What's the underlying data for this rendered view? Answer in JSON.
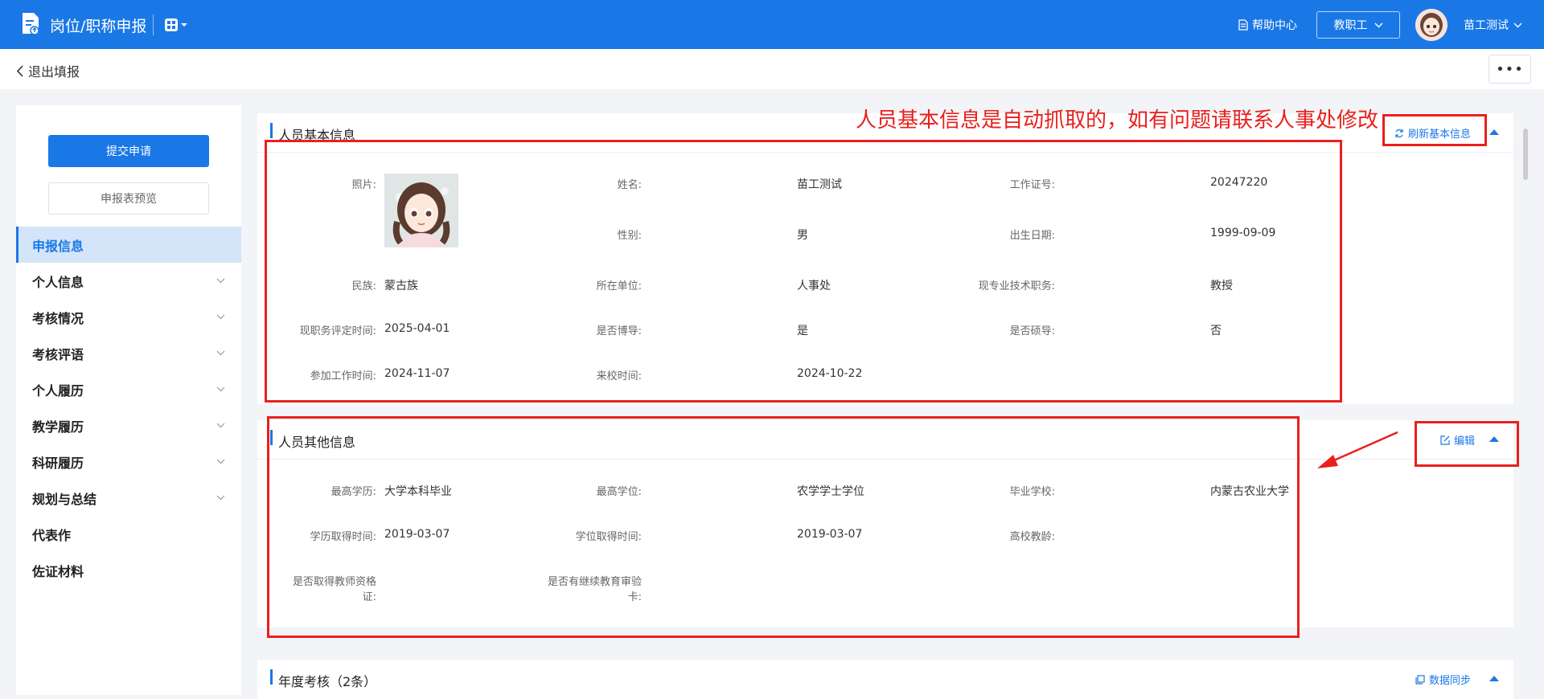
{
  "topbar": {
    "app_title": "岗位/职称申报",
    "help_label": "帮助中心",
    "role_label": "教职工",
    "user_name": "苗工测试"
  },
  "subbar": {
    "exit_label": "退出填报",
    "more_label": "•••"
  },
  "sidebar": {
    "submit_label": "提交申请",
    "preview_label": "申报表预览",
    "items": [
      {
        "label": "申报信息",
        "active": true,
        "chevron": false
      },
      {
        "label": "个人信息",
        "chevron": true
      },
      {
        "label": "考核情况",
        "chevron": true
      },
      {
        "label": "考核评语",
        "chevron": true
      },
      {
        "label": "个人履历",
        "chevron": true
      },
      {
        "label": "教学履历",
        "chevron": true
      },
      {
        "label": "科研履历",
        "chevron": true
      },
      {
        "label": "规划与总结",
        "chevron": true
      },
      {
        "label": "代表作",
        "chevron": false
      },
      {
        "label": "佐证材料",
        "chevron": false
      }
    ]
  },
  "annotation": "人员基本信息是自动抓取的，如有问题请联系人事处修改",
  "basic_info": {
    "title": "人员基本信息",
    "action_label": "刷新基本信息",
    "photo_label": "照片:",
    "name_label": "姓名:",
    "name_value": "苗工测试",
    "work_id_label": "工作证号:",
    "work_id_value": "20247220",
    "gender_label": "性别:",
    "gender_value": "男",
    "birth_label": "出生日期:",
    "birth_value": "1999-09-09",
    "ethnic_label": "民族:",
    "ethnic_value": "蒙古族",
    "unit_label": "所在单位:",
    "unit_value": "人事处",
    "title_label": "现专业技术职务:",
    "title_value": "教授",
    "eval_time_label": "现职务评定时间:",
    "eval_time_value": "2025-04-01",
    "phd_label": "是否博导:",
    "phd_value": "是",
    "master_label": "是否硕导:",
    "master_value": "否",
    "work_start_label": "参加工作时间:",
    "work_start_value": "2024-11-07",
    "arrive_label": "来校时间:",
    "arrive_value": "2024-10-22"
  },
  "other_info": {
    "title": "人员其他信息",
    "action_label": "编辑",
    "edu_label": "最高学历:",
    "edu_value": "大学本科毕业",
    "degree_label": "最高学位:",
    "degree_value": "农学学士学位",
    "school_label": "毕业学校:",
    "school_value": "内蒙古农业大学",
    "edu_time_label": "学历取得时间:",
    "edu_time_value": "2019-03-07",
    "degree_time_label": "学位取得时间:",
    "degree_time_value": "2019-03-07",
    "teach_age_label": "高校教龄:",
    "teacher_cert_label_1": "是否取得教师资格",
    "teacher_cert_label_2": "证:",
    "cont_edu_label_1": "是否有继续教育审验",
    "cont_edu_label_2": "卡:"
  },
  "annual": {
    "title": "年度考核（2条）",
    "action_label": "数据同步"
  },
  "colors": {
    "primary": "#1a78e6",
    "annotation_red": "#e8201e",
    "nav_active_bg": "#d4e5fa"
  }
}
